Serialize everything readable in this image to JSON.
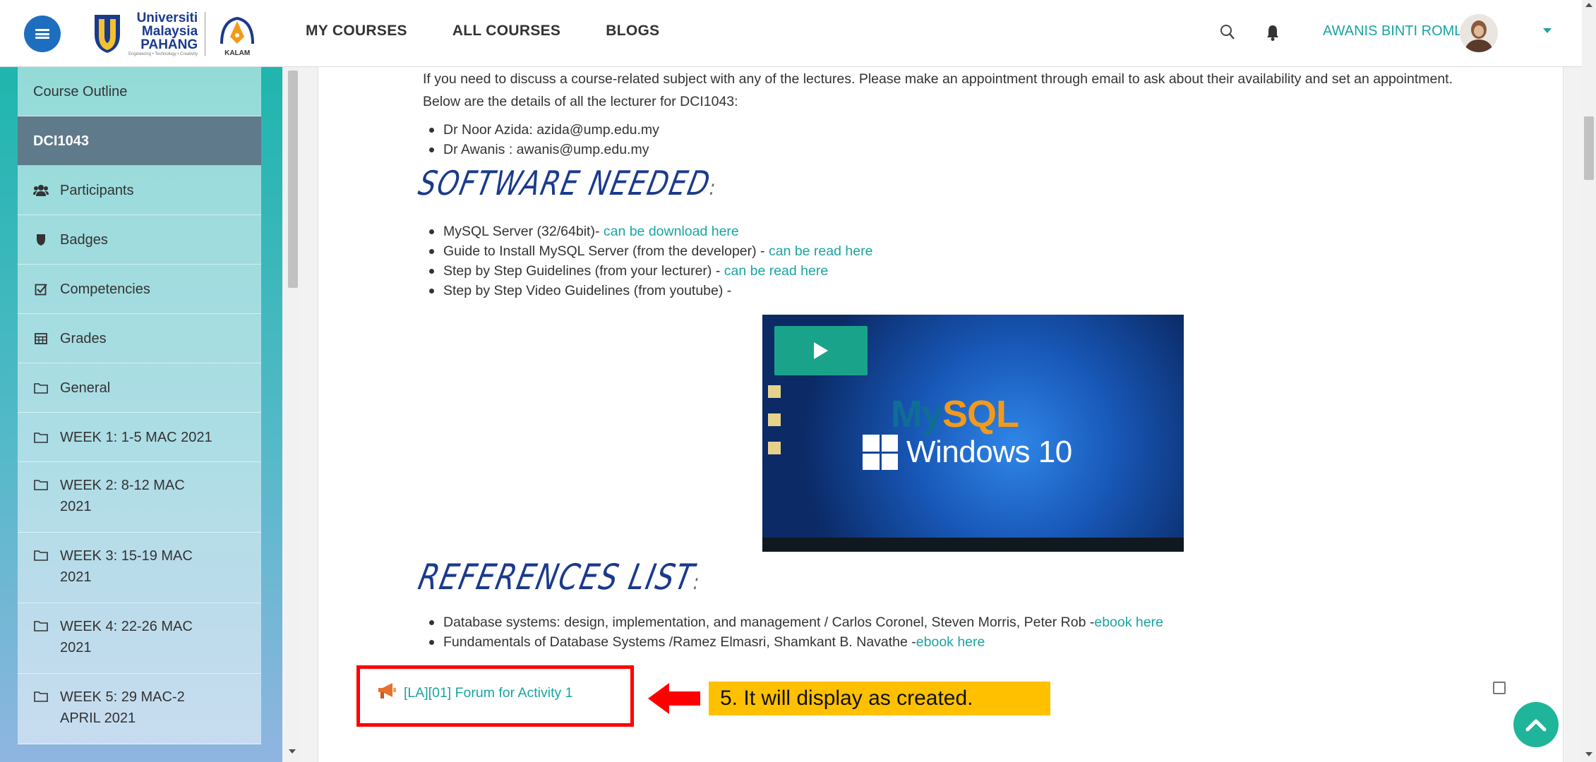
{
  "header": {
    "logo": {
      "line1": "Universiti",
      "line2": "Malaysia",
      "line3": "PAHANG",
      "tagline": "Engineering • Technology • Creativity",
      "kalam": "KALAM"
    },
    "nav": [
      "MY COURSES",
      "ALL COURSES",
      "BLOGS"
    ],
    "user_name": "AWANIS BINTI ROMLI ."
  },
  "sidebar": {
    "items": [
      {
        "label": "Course Outline",
        "icon": ""
      },
      {
        "label": "DCI1043",
        "icon": ""
      },
      {
        "label": "Participants",
        "icon": "users-icon"
      },
      {
        "label": "Badges",
        "icon": "shield-icon"
      },
      {
        "label": "Competencies",
        "icon": "checkbox-icon"
      },
      {
        "label": "Grades",
        "icon": "table-icon"
      },
      {
        "label": "General",
        "icon": "folder-icon"
      },
      {
        "label": "WEEK 1: 1-5 MAC 2021",
        "icon": "folder-icon"
      },
      {
        "label": "WEEK 2: 8-12 MAC 2021",
        "icon": "folder-icon"
      },
      {
        "label": "WEEK 3: 15-19 MAC 2021",
        "icon": "folder-icon"
      },
      {
        "label": "WEEK 4: 22-26 MAC 2021",
        "icon": "folder-icon"
      },
      {
        "label": "WEEK 5: 29 MAC-2 APRIL 2021",
        "icon": "folder-icon"
      }
    ]
  },
  "content": {
    "intro": "If you need to discuss a course-related subject with any of the lectures. Please make an appointment through email to ask about their availability and set an appointment. Below are the details of all the lecturer for DCI1043:",
    "lecturers": [
      "Dr Noor Azida: azida@ump.edu.my",
      "Dr Awanis : awanis@ump.edu.my"
    ],
    "software_heading": "SOFTWARE NEEDED",
    "software": [
      {
        "text": "MySQL Server (32/64bit)- ",
        "link": "can be download here"
      },
      {
        "text": "Guide to Install MySQL Server (from the developer) - ",
        "link": "can be read here"
      },
      {
        "text": "Step by Step Guidelines (from your lecturer) - ",
        "link": "can be read here"
      },
      {
        "text": "Step by Step Video Guidelines (from youtube) -",
        "link": ""
      }
    ],
    "video": {
      "brand_a": "My",
      "brand_b": "SQL",
      "os": "Windows 10"
    },
    "references_heading": "REFERENCES LIST",
    "references": [
      {
        "text": "Database systems: design, implementation, and management / Carlos Coronel, Steven Morris, Peter Rob -",
        "link": "ebook here"
      },
      {
        "text": "Fundamentals of Database Systems /Ramez Elmasri, Shamkant B. Navathe  -",
        "link": "ebook here"
      }
    ],
    "forum_link": "[LA][01] Forum for Activity 1",
    "callout": "5. It will display as created."
  },
  "colors": {
    "accent": "#1aa3a3",
    "menu_button": "#1e6ec0",
    "heading": "#1a3a8c",
    "highlight_border": "#ff0000",
    "callout_bg": "#ffc000"
  }
}
